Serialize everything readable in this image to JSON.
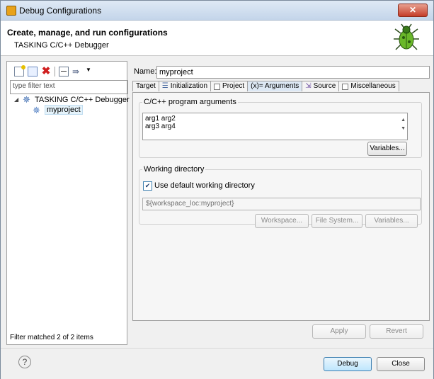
{
  "window": {
    "title": "Debug Configurations",
    "close_glyph": "✕"
  },
  "banner": {
    "heading": "Create, manage, and run configurations",
    "subtitle": "TASKING C/C++ Debugger"
  },
  "left": {
    "filter_placeholder": "type filter text",
    "tree": [
      {
        "label": "TASKING C/C++ Debugger",
        "expanded": true
      },
      {
        "label": "myproject",
        "selected": true
      }
    ],
    "status": "Filter matched 2 of 2 items"
  },
  "config": {
    "name_label": "Name:",
    "name_value": "myproject",
    "tabs": [
      "Target",
      "Initialization",
      "Project",
      "(x)= Arguments",
      "Source",
      "Miscellaneous"
    ],
    "active_tab": "(x)= Arguments",
    "program_args": {
      "group_label": "C/C++ program arguments",
      "lines": [
        "arg1 arg2",
        "arg3 arg4"
      ],
      "variables_button": "Variables..."
    },
    "working_dir": {
      "group_label": "Working directory",
      "use_default_label": "Use default working directory",
      "use_default_checked": true,
      "path": "${workspace_loc:myproject}",
      "workspace_button": "Workspace...",
      "filesystem_button": "File System...",
      "variables_button": "Variables..."
    },
    "apply_button": "Apply",
    "revert_button": "Revert"
  },
  "footer": {
    "help_glyph": "?",
    "debug_button": "Debug",
    "close_button": "Close"
  },
  "colors": {
    "accent": "#3c7fb1",
    "selection": "#e5f3fb"
  }
}
